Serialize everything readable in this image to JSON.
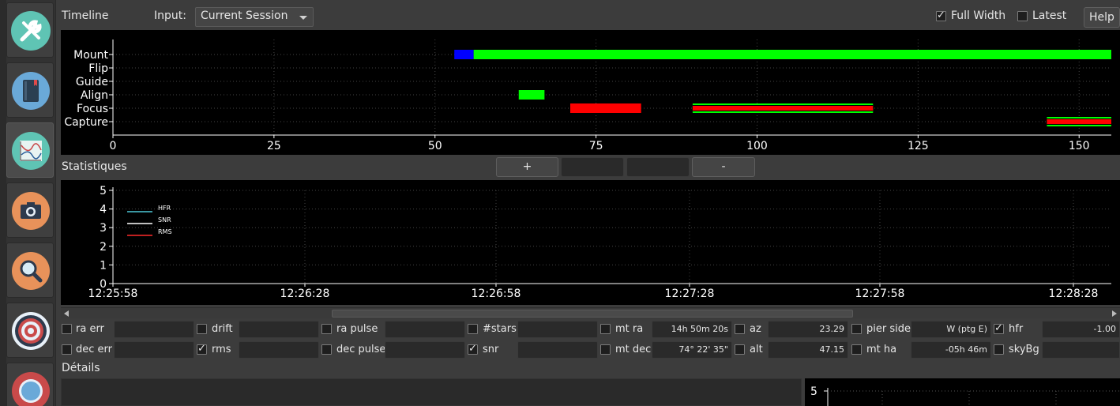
{
  "dock": {
    "items": [
      {
        "name": "setup-tools",
        "icon": "tools-icon",
        "color": "#5fc4b4"
      },
      {
        "name": "scheduler",
        "icon": "notebook-icon",
        "color": "#6aa9d8"
      },
      {
        "name": "analyze",
        "icon": "graph-icon",
        "color": "#5fc4b4"
      },
      {
        "name": "capture",
        "icon": "camera-icon",
        "color": "#e8925a"
      },
      {
        "name": "focus",
        "icon": "magnifier-icon",
        "color": "#e8925a"
      },
      {
        "name": "align",
        "icon": "target-icon",
        "color": "#c94a4a"
      },
      {
        "name": "guide",
        "icon": "compass-icon",
        "color": "#c94a4a"
      }
    ]
  },
  "header": {
    "timeline_label": "Timeline",
    "input_label": "Input:",
    "input_value": "Current Session",
    "full_width_label": "Full Width",
    "full_width_checked": true,
    "latest_label": "Latest",
    "latest_checked": false,
    "help_label": "Help"
  },
  "timeline_chart": {
    "type": "bar",
    "categories": [
      "Mount",
      "Flip",
      "Guide",
      "Align",
      "Focus",
      "Capture"
    ],
    "xlim": [
      0,
      155
    ],
    "x_ticks": [
      "0",
      "25",
      "50",
      "75",
      "100",
      "125",
      "150"
    ],
    "x_tick_values": [
      0,
      25,
      50,
      75,
      100,
      125,
      150
    ],
    "segments": [
      {
        "category": "Mount",
        "start": 53,
        "end": 56,
        "color": "#0000ff"
      },
      {
        "category": "Mount",
        "start": 56,
        "end": 155,
        "color": "#00ff00"
      },
      {
        "category": "Align",
        "start": 63,
        "end": 67,
        "color": "#00ff00"
      },
      {
        "category": "Focus",
        "start": 71,
        "end": 82,
        "color": "#ff0000"
      },
      {
        "category": "Focus",
        "start": 90,
        "end": 118,
        "color": "#ff0000",
        "outline": "#00ff00"
      },
      {
        "category": "Capture",
        "start": 145,
        "end": 155,
        "color": "#ff0000",
        "outline": "#00ff00"
      }
    ]
  },
  "stats": {
    "title": "Statistiques",
    "plus_label": "+",
    "minus_label": "-"
  },
  "stats_chart": {
    "type": "line",
    "ylim": [
      0,
      5
    ],
    "y_ticks": [
      "0",
      "1",
      "2",
      "3",
      "4",
      "5"
    ],
    "x_ticks": [
      "12:25:58",
      "12:26:28",
      "12:26:58",
      "12:27:28",
      "12:27:58",
      "12:28:28"
    ],
    "series": [
      {
        "name": "HFR",
        "color": "#4ec9d8",
        "values": []
      },
      {
        "name": "SNR",
        "color": "#ffffff",
        "values": []
      },
      {
        "name": "RMS",
        "color": "#ff2a2a",
        "values": []
      }
    ]
  },
  "fields": {
    "row1": [
      {
        "label": "ra err",
        "checked": false,
        "value": ""
      },
      {
        "label": "drift",
        "checked": false,
        "value": ""
      },
      {
        "label": "ra pulse",
        "checked": false,
        "value": ""
      },
      {
        "label": "#stars",
        "checked": false,
        "value": ""
      },
      {
        "label": "mt ra",
        "checked": false,
        "value": "14h 50m 20s"
      },
      {
        "label": "az",
        "checked": false,
        "value": "23.29"
      },
      {
        "label": "pier side",
        "checked": false,
        "value": "W (ptg E)"
      },
      {
        "label": "hfr",
        "checked": true,
        "value": "-1.00"
      }
    ],
    "row2": [
      {
        "label": "dec err",
        "checked": false,
        "value": ""
      },
      {
        "label": "rms",
        "checked": true,
        "value": ""
      },
      {
        "label": "dec pulse",
        "checked": false,
        "value": ""
      },
      {
        "label": "snr",
        "checked": true,
        "value": ""
      },
      {
        "label": "mt dec",
        "checked": false,
        "value": "74° 22' 35\""
      },
      {
        "label": "alt",
        "checked": false,
        "value": "47.15"
      },
      {
        "label": "mt ha",
        "checked": false,
        "value": "-05h 46m"
      },
      {
        "label": "skyBg",
        "checked": false,
        "value": ""
      }
    ]
  },
  "details": {
    "title": "Détails",
    "mini_plot_y_top": "5"
  }
}
